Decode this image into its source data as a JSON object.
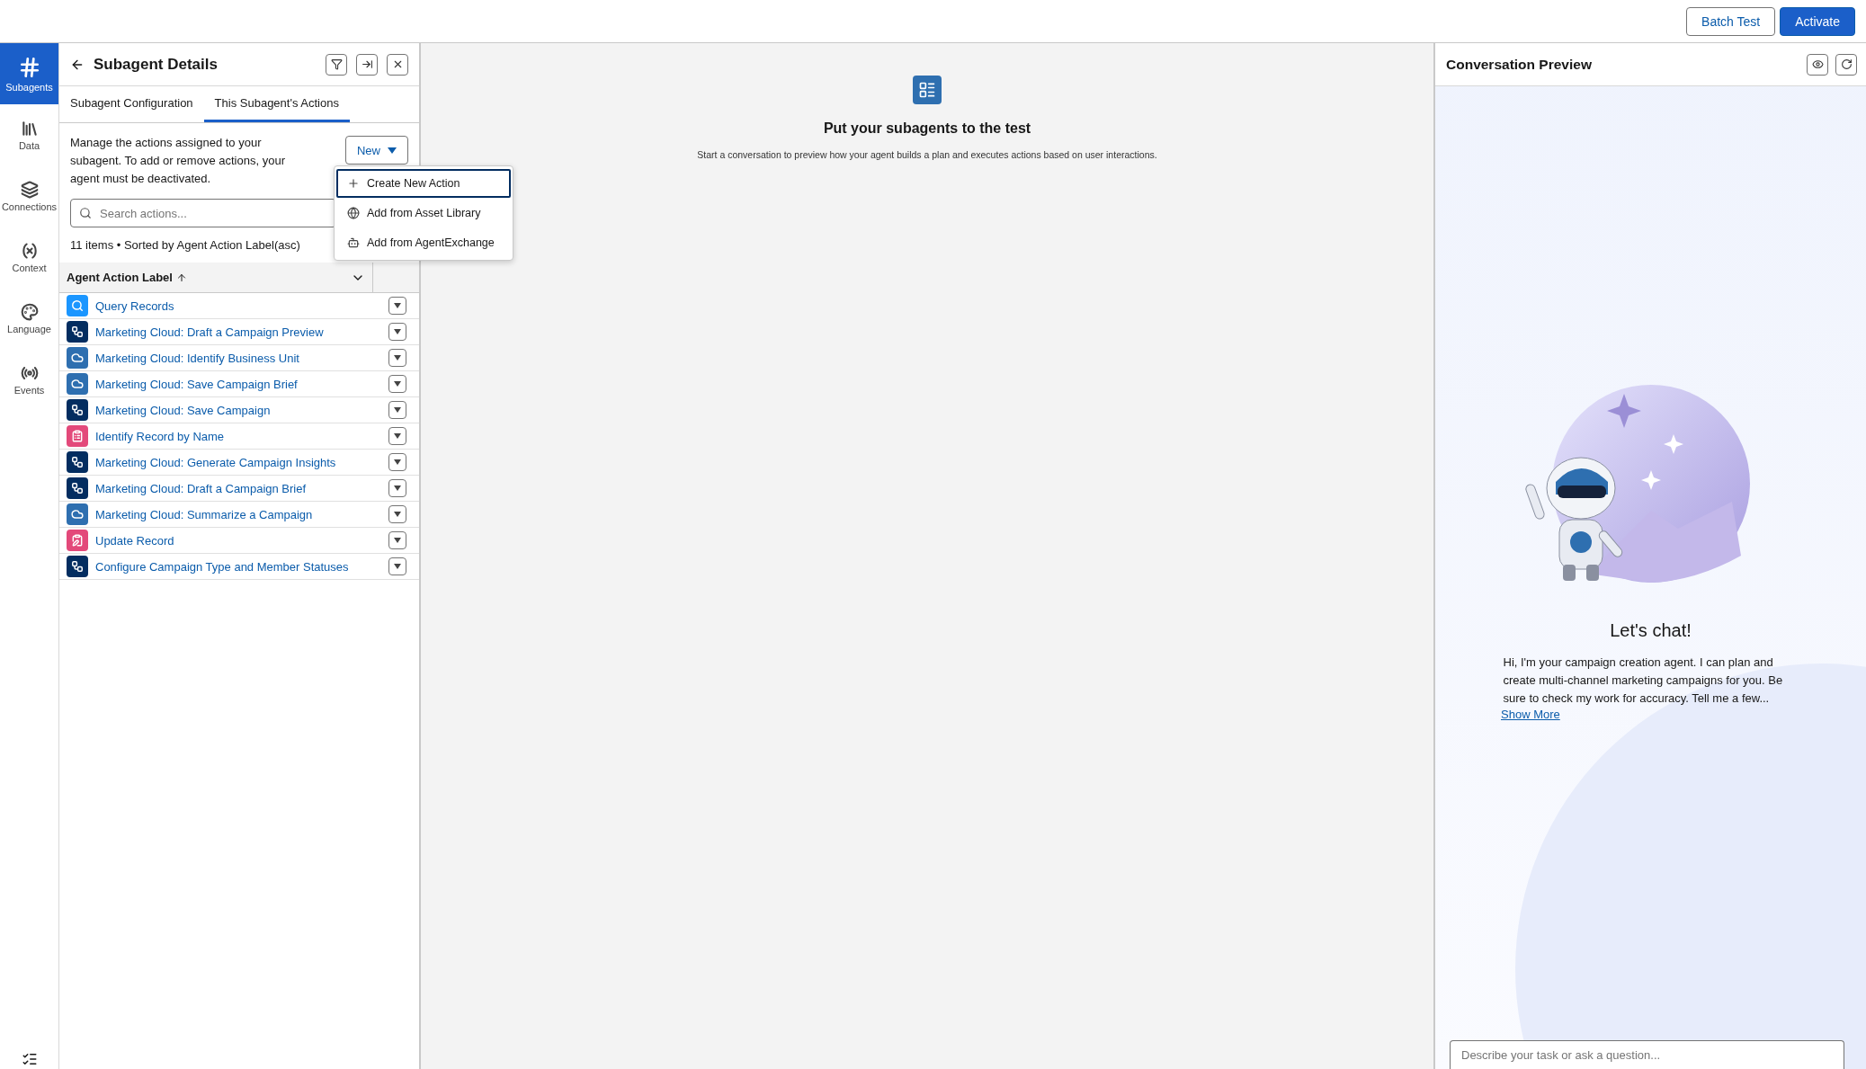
{
  "top_bar": {
    "buttons": [
      {
        "label": "Batch Test",
        "kind": "neutral"
      },
      {
        "label": "Activate",
        "kind": "brand"
      }
    ]
  },
  "rail": {
    "items": [
      {
        "label": "Subagents",
        "selected": true
      },
      {
        "label": "Data",
        "selected": false
      },
      {
        "label": "Connections",
        "selected": false
      },
      {
        "label": "Context",
        "selected": false
      },
      {
        "label": "Language",
        "selected": false
      },
      {
        "label": "Events",
        "selected": false
      }
    ]
  },
  "details_panel": {
    "title": "Subagent Details",
    "tabs": [
      {
        "label": "Subagent Configuration",
        "selected": false
      },
      {
        "label": "This Subagent's Actions",
        "selected": true
      }
    ],
    "description": "Manage the actions assigned to your subagent. To add or remove actions, your agent must be deactivated.",
    "new_button": {
      "label": "New"
    },
    "new_menu": [
      {
        "label": "Create New Action",
        "selected": true
      },
      {
        "label": "Add from Asset Library",
        "selected": false
      },
      {
        "label": "Add from AgentExchange",
        "selected": false
      }
    ],
    "search": {
      "placeholder": "Search actions..."
    },
    "summary": "11 items • Sorted by Agent Action Label(asc)",
    "table": {
      "columns": [
        "Agent Action Label"
      ],
      "rows": [
        {
          "label": "Query Records",
          "kind": "search"
        },
        {
          "label": "Marketing Cloud: Draft a Campaign Preview",
          "kind": "flow"
        },
        {
          "label": "Marketing Cloud: Identify Business Unit",
          "kind": "cloud"
        },
        {
          "label": "Marketing Cloud: Save Campaign Brief",
          "kind": "cloud"
        },
        {
          "label": "Marketing Cloud: Save Campaign",
          "kind": "flow"
        },
        {
          "label": "Identify Record by Name",
          "kind": "record"
        },
        {
          "label": "Marketing Cloud: Generate Campaign Insights",
          "kind": "flow"
        },
        {
          "label": "Marketing Cloud: Draft a Campaign Brief",
          "kind": "flow"
        },
        {
          "label": "Marketing Cloud: Summarize a Campaign",
          "kind": "cloud"
        },
        {
          "label": "Update Record",
          "kind": "update"
        },
        {
          "label": "Configure Campaign Type and Member Statuses",
          "kind": "flow"
        }
      ]
    }
  },
  "canvas": {
    "title": "Put your subagents to the test",
    "text": "Start a conversation to preview how your agent builds a plan and executes actions based on user interactions."
  },
  "preview": {
    "title": "Conversation Preview",
    "greeting": "Let's chat!",
    "message": "Hi, I'm your campaign creation agent. I can plan and create multi-channel marketing campaigns for you. Be sure to check my work for accuracy. Tell me a few...",
    "link": "Show More",
    "input": {
      "placeholder": "Describe your task or ask a question..."
    }
  }
}
